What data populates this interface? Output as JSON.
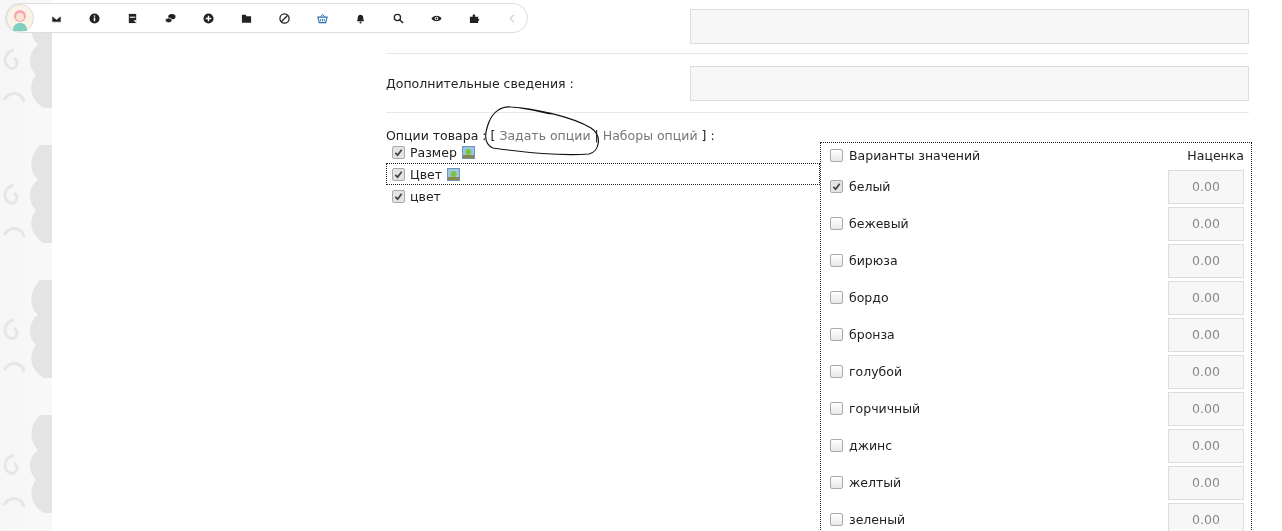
{
  "form": {
    "extra_label": "Дополнительные сведения :"
  },
  "options": {
    "label": "Опции товара :",
    "open_bracket": "[",
    "links": [
      "Задать опции",
      "Наборы опций"
    ],
    "separator": "|",
    "close": "] :",
    "items": [
      {
        "name": "Размер",
        "checked": true,
        "image": true,
        "selected": false
      },
      {
        "name": "Цвет",
        "checked": true,
        "image": true,
        "selected": true
      },
      {
        "name": "цвет",
        "checked": true,
        "image": false,
        "selected": false
      }
    ]
  },
  "variants": {
    "header": {
      "label": "Варианты значений",
      "checked": false
    },
    "markup_heading": "Наценка",
    "rows": [
      {
        "name": "белый",
        "checked": true,
        "markup": "0.00"
      },
      {
        "name": "бежевый",
        "checked": false,
        "markup": "0.00"
      },
      {
        "name": "бирюза",
        "checked": false,
        "markup": "0.00"
      },
      {
        "name": "бордо",
        "checked": false,
        "markup": "0.00"
      },
      {
        "name": "бронза",
        "checked": false,
        "markup": "0.00"
      },
      {
        "name": "голубой",
        "checked": false,
        "markup": "0.00"
      },
      {
        "name": "горчичный",
        "checked": false,
        "markup": "0.00"
      },
      {
        "name": "джинс",
        "checked": false,
        "markup": "0.00"
      },
      {
        "name": "желтый",
        "checked": false,
        "markup": "0.00"
      },
      {
        "name": "зеленый",
        "checked": false,
        "markup": "0.00"
      }
    ]
  }
}
